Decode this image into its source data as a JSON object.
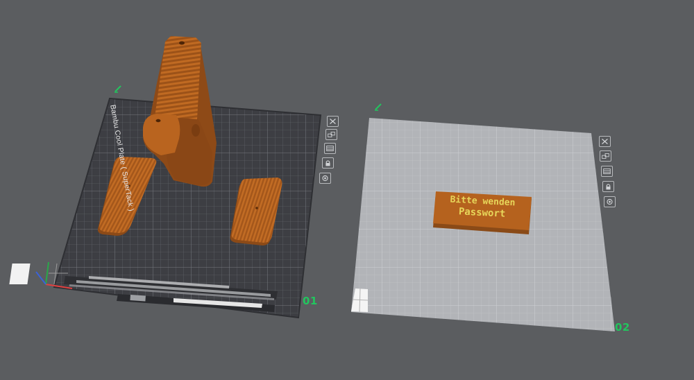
{
  "plates": [
    {
      "number": "01",
      "name": "Bambu Cool Plate ( SuperTack )",
      "toolbar": [
        "delete-plate",
        "arrange",
        "orient",
        "lock",
        "settings"
      ]
    },
    {
      "number": "02",
      "toolbar": [
        "delete-plate",
        "arrange",
        "orient",
        "lock",
        "settings"
      ]
    }
  ],
  "objects": {
    "label_block": {
      "line1": "Bitte wenden",
      "line2": "Passwort"
    }
  },
  "colors": {
    "background": "#5b5d60",
    "plate1_surface": "#3e3f44",
    "plate2_surface": "#b2b4b8",
    "model_orange": "#b5621e",
    "label_text": "#e7d65a",
    "plate_number": "#22c55e"
  }
}
